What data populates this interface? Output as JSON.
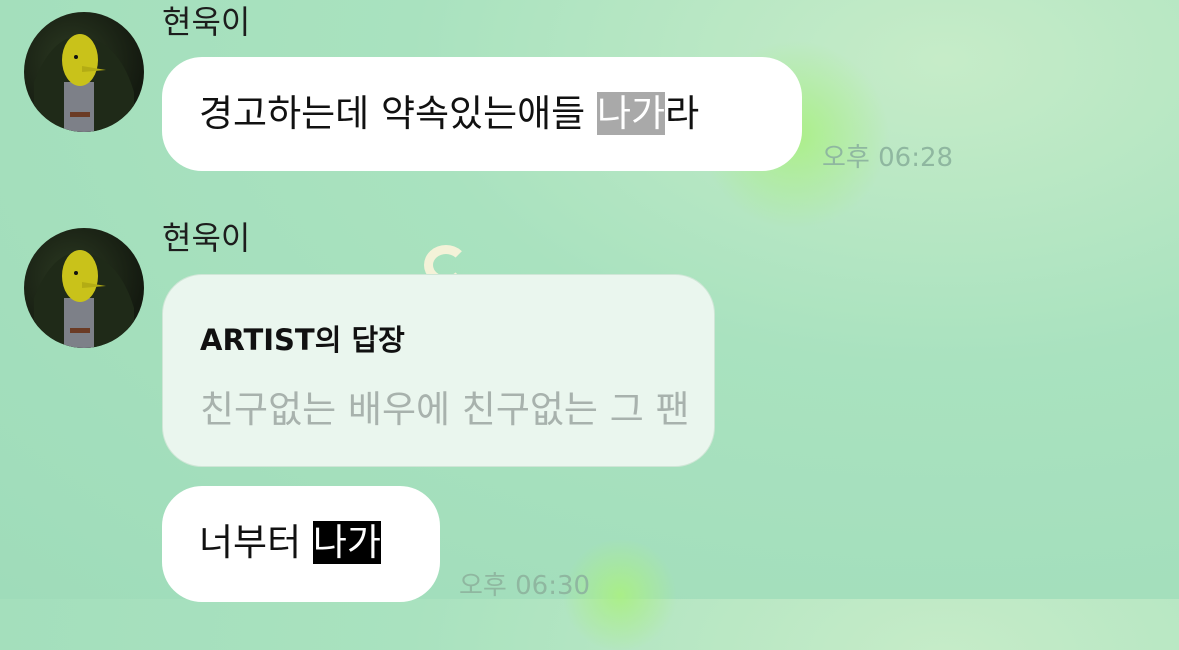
{
  "messages": [
    {
      "sender": "현욱이",
      "text_before": "경고하는데 약속있는애들 ",
      "highlight": "나가",
      "text_after": "라",
      "time": "오후 06:28"
    },
    {
      "sender": "현욱이",
      "reply": {
        "title": "ARTIST의 답장",
        "quoted": "친구없는 배우에 친구없는 그 팬"
      },
      "text_before": "너부터 ",
      "highlight": "나가",
      "time": "오후 06:30"
    }
  ],
  "colors": {
    "background": "#a9e2bf",
    "bubble": "#ffffff",
    "highlight_gray": "#a9a9a9",
    "highlight_black": "#000000",
    "timestamp": "#8fb7a0"
  }
}
